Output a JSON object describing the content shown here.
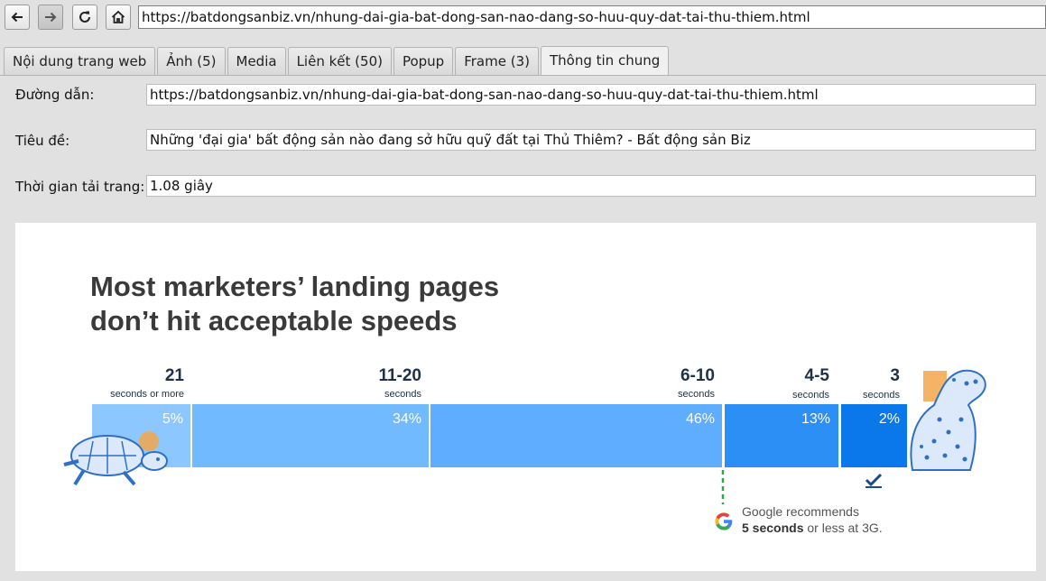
{
  "toolbar": {
    "url": "https://batdongsanbiz.vn/nhung-dai-gia-bat-dong-san-nao-dang-so-huu-quy-dat-tai-thu-thiem.html"
  },
  "tabs": [
    {
      "label": "Nội dung trang web"
    },
    {
      "label": "Ảnh (5)"
    },
    {
      "label": "Media"
    },
    {
      "label": "Liên kết (50)"
    },
    {
      "label": "Popup"
    },
    {
      "label": "Frame (3)"
    },
    {
      "label": "Thông tin chung"
    }
  ],
  "info": {
    "url_label": "Đường dẫn:",
    "url_value": "https://batdongsanbiz.vn/nhung-dai-gia-bat-dong-san-nao-dang-so-huu-quy-dat-tai-thu-thiem.html",
    "title_label": "Tiêu đề:",
    "title_value": "Những 'đại gia' bất động sản nào đang sở hữu quỹ đất tại Thủ Thiêm? - Bất động sản Biz",
    "load_label": "Thời gian tải trang:",
    "load_value": "1.08 giây"
  },
  "preview": {
    "headline_line1": "Most marketers’ landing pages",
    "headline_line2": "don’t hit acceptable speeds",
    "segments": [
      {
        "big": "21",
        "small": "seconds or more",
        "pct": "5%",
        "color": "#8cc8ff"
      },
      {
        "big": "11-20",
        "small": "seconds",
        "pct": "34%",
        "color": "#72baff"
      },
      {
        "big": "6-10",
        "small": "seconds",
        "pct": "46%",
        "color": "#5eadff"
      },
      {
        "big": "4-5",
        "small": "seconds",
        "pct": "13%",
        "color": "#2c8ff5"
      },
      {
        "big": "3",
        "small": "seconds",
        "pct": "2%",
        "color": "#0a78ea"
      }
    ],
    "google_line1": "Google recommends",
    "google_line2_bold": "5 seconds",
    "google_line2_rest": " or less at 3G."
  }
}
